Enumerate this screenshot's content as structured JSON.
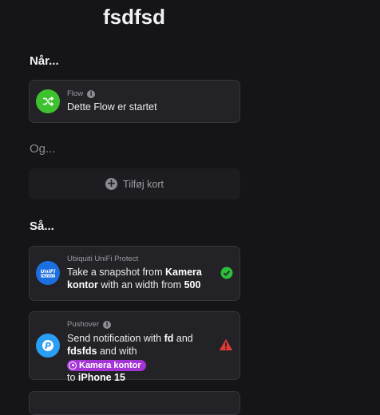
{
  "flow": {
    "title": "fsdfsd"
  },
  "sections": {
    "when": "Når...",
    "and": "Og...",
    "then": "Så..."
  },
  "trigger": {
    "app": "Flow",
    "text": "Dette Flow er startet",
    "icon": "flow-shuffle-icon",
    "color": "#3ec12f"
  },
  "add_card": {
    "label": "Tilføj kort",
    "icon": "plus-icon"
  },
  "actions": [
    {
      "app": "Ubiquiti UniFi Protect",
      "icon": "unifi-protect-icon",
      "color": "#1b6fe0",
      "status": "success",
      "status_color": "#2bbf3a",
      "parts": [
        "Take a snapshot from ",
        "Kamera kontor",
        " with an width from ",
        "500"
      ]
    },
    {
      "app": "Pushover",
      "icon": "pushover-icon",
      "color": "#2a9df4",
      "status": "warning",
      "status_color": "#e53935",
      "parts": [
        "Send notification with ",
        "fd",
        " and ",
        "fdsfds",
        " and with ",
        "Kamera kontor",
        " to ",
        "iPhone 15"
      ]
    }
  ]
}
